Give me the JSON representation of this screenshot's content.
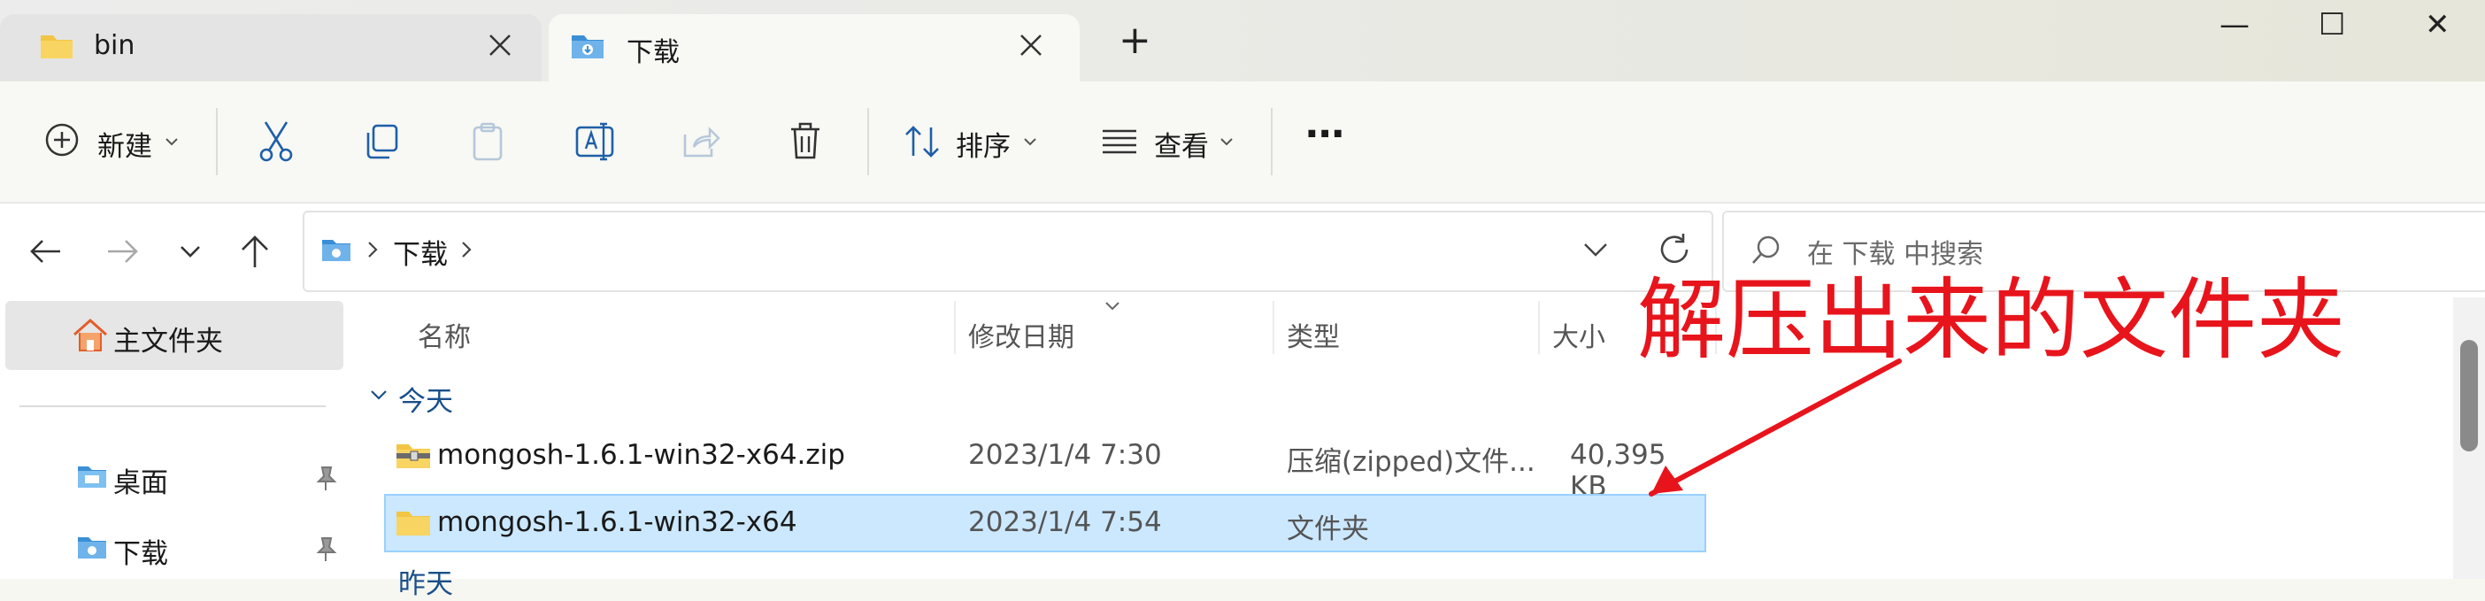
{
  "tabs": [
    {
      "label": "bin"
    },
    {
      "label": "下载"
    }
  ],
  "new_tab": "+",
  "window_controls": {
    "minimize": "—",
    "maximize": "☐",
    "close": "✕"
  },
  "toolbar": {
    "new_label": "新建",
    "sort_label": "排序",
    "view_label": "查看",
    "more": "···"
  },
  "address": {
    "path_item": "下载",
    "search_placeholder": "在 下载 中搜索"
  },
  "sidebar": {
    "home": "主文件夹",
    "items": [
      {
        "label": "桌面"
      },
      {
        "label": "下载"
      }
    ]
  },
  "columns": {
    "name": "名称",
    "date": "修改日期",
    "type": "类型",
    "size": "大小"
  },
  "group": "今天",
  "next_group": "昨天",
  "files": [
    {
      "name": "mongosh-1.6.1-win32-x64.zip",
      "date": "2023/1/4 7:30",
      "type": "压缩(zipped)文件...",
      "size": "40,395 KB"
    },
    {
      "name": "mongosh-1.6.1-win32-x64",
      "date": "2023/1/4 7:54",
      "type": "文件夹",
      "size": ""
    }
  ],
  "annotation": "解压出来的文件夹",
  "colors": {
    "accent": "#0067c0",
    "selected": "#cce8ff",
    "annotation": "#e8141c",
    "folder": "#f3c544"
  }
}
